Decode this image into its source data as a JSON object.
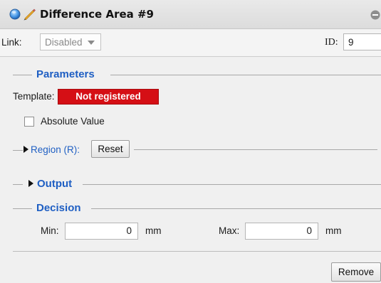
{
  "window": {
    "title": "Difference Area #9",
    "icons": [
      "circle-icon",
      "pencil-icon",
      "collapse-icon"
    ]
  },
  "link_bar": {
    "link_label": "Link:",
    "link_value": "Disabled",
    "id_label": "ID:",
    "id_value": "9"
  },
  "parameters": {
    "heading": "Parameters",
    "template_label": "Template:",
    "template_status": "Not registered",
    "absolute_value_label": "Absolute Value",
    "absolute_value_checked": false,
    "region_label": "Region (R):",
    "reset_label": "Reset"
  },
  "output": {
    "heading": "Output"
  },
  "decision": {
    "heading": "Decision",
    "min_label": "Min:",
    "min_value": "0",
    "min_unit": "mm",
    "max_label": "Max:",
    "max_value": "0",
    "max_unit": "mm"
  },
  "footer": {
    "remove_label": "Remove"
  },
  "colors": {
    "accent_blue": "#1f5fc3",
    "status_red": "#d50f15"
  }
}
